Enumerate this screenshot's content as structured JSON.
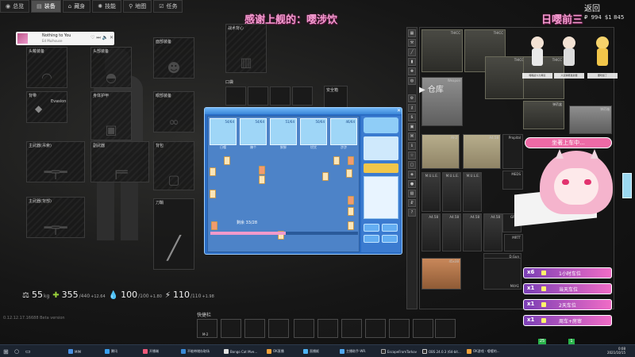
{
  "nav": {
    "tabs": [
      {
        "label": "总览",
        "icon": "person-icon",
        "active": false
      },
      {
        "label": "装备",
        "icon": "hanger-icon",
        "active": true
      },
      {
        "label": "藏身",
        "icon": "cabin-icon",
        "active": false
      },
      {
        "label": "技能",
        "icon": "brain-icon",
        "active": false
      },
      {
        "label": "地图",
        "icon": "map-pin-icon",
        "active": false
      },
      {
        "label": "任务",
        "icon": "check-list-icon",
        "active": false
      }
    ],
    "back_label": "返回",
    "currency_a": "994",
    "currency_b": "$1 845"
  },
  "stream": {
    "title": "感谢上舰的：嘤涉饮",
    "right_title": "日嘤前三"
  },
  "player": {
    "song": "Nothing to You",
    "artist": "Ed Mulhouse"
  },
  "equipment": {
    "slots": [
      {
        "label": "头戴装备",
        "icon": "headset-icon"
      },
      {
        "label": "面部装备",
        "icon": "mask-icon"
      },
      {
        "label": "战术背心",
        "icon": "vest-icon"
      },
      {
        "label": "头部装备",
        "icon": "helmet-icon"
      },
      {
        "label": "背带",
        "sub": "Evasion",
        "icon": "armband-icon"
      },
      {
        "label": "身体护甲",
        "icon": "armor-icon"
      },
      {
        "label": "眼部装备",
        "icon": "goggles-icon"
      },
      {
        "label": "口袋",
        "icon": "pocket-icon"
      },
      {
        "label": "安全箱",
        "icon": "container-icon"
      },
      {
        "label": "主武器(吊索)",
        "icon": "rifle-icon"
      },
      {
        "label": "背包",
        "icon": "backpack-icon"
      },
      {
        "label": "副武器",
        "icon": "pistol-icon"
      },
      {
        "label": "主武器(背部)",
        "icon": "rifle-icon"
      },
      {
        "label": "刀鞘",
        "icon": "knife-icon"
      }
    ]
  },
  "stats": {
    "weight": {
      "value": "55",
      "unit": "kg"
    },
    "health": {
      "value": "355",
      "max": "/440",
      "rate": "+12.64"
    },
    "hydration": {
      "value": "100",
      "max": "/100",
      "rate": "+1.80"
    },
    "energy": {
      "value": "110",
      "max": "/110",
      "rate": "+1.98"
    }
  },
  "version": "0.12.12.17.16688 Beta version",
  "quickbar": {
    "label": "快捷栏",
    "knife_label": "M-2"
  },
  "mahjong": {
    "players": [
      {
        "name": "日嘤",
        "score": "54/64"
      },
      {
        "name": "辣个",
        "score": "54/64"
      },
      {
        "name": "鲜鲜",
        "score": "51/64"
      },
      {
        "name": "忧忧",
        "score": "50/64"
      },
      {
        "name": "涉涉",
        "score": "46/64"
      }
    ],
    "progress_text": "剩余 33/28",
    "progress_fraction": 0.51
  },
  "stash": {
    "title": "仓库",
    "items": [
      {
        "name": "THICC"
      },
      {
        "name": "THICC"
      },
      {
        "name": "THICC"
      },
      {
        "name": "THICC"
      },
      {
        "name": "Weapon"
      },
      {
        "name": "弹药盒"
      },
      {
        "name": "弹药箱"
      },
      {
        "name": "AI-2"
      },
      {
        "name": "A4.58"
      },
      {
        "name": "Propital"
      },
      {
        "name": "MEDS"
      },
      {
        "name": "M.U.L.E."
      },
      {
        "name": "M.U.L.E."
      },
      {
        "name": "M.U.L.E."
      },
      {
        "name": "A4.58"
      },
      {
        "name": "A4.58"
      },
      {
        "name": "A4.58"
      },
      {
        "name": "A4.58"
      },
      {
        "name": "GPBX"
      },
      {
        "name": "D.Gun"
      },
      {
        "name": "MRTT"
      },
      {
        "name": "45x38"
      },
      {
        "name": "M4A1"
      }
    ]
  },
  "overlay": {
    "chibi_tags": [
      "嘤嘤战斗力爆表",
      "六道弹幕发射器",
      "要吃饭了"
    ],
    "boarding": "坐著上车中...",
    "tickets": [
      {
        "count": "x6",
        "text": "1小时车位"
      },
      {
        "count": "x1",
        "text": "当天车位"
      },
      {
        "count": "x1",
        "text": "2天车位"
      },
      {
        "count": "x1",
        "text": "周车+房审"
      }
    ]
  },
  "taskbar": {
    "items": [
      "MIM",
      "腾讯",
      "开播端",
      "不能带储存取场",
      "Bongo Cat Mve...",
      "OK直播",
      "直播姬",
      "主播助手-WR.",
      "EscapeFromTarkov",
      "OBS 24.0.3 (64-bit...",
      "OK游戏 - 嘤嘤的..."
    ],
    "time": "0:08",
    "date": "2021/10/15"
  },
  "indicators": {
    "a": "25",
    "b": "1"
  }
}
